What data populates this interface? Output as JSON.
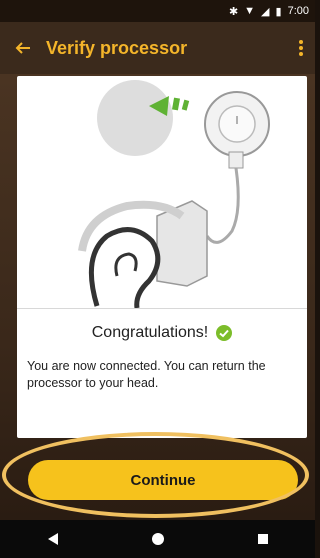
{
  "status_bar": {
    "bluetooth_icon": "bluetooth-icon",
    "wifi_icon": "wifi-icon",
    "signal_icon": "signal-icon",
    "battery_icon": "battery-icon",
    "time": "7:00"
  },
  "app_bar": {
    "back_icon": "arrow-left-icon",
    "title": "Verify processor",
    "menu_icon": "more-vert-icon"
  },
  "card": {
    "heading": "Congratulations!",
    "check_icon": "check-circle-icon",
    "message": "You are now connected. You can return the processor to your head."
  },
  "actions": {
    "continue_label": "Continue"
  },
  "nav_bar": {
    "back_icon": "triangle-back-icon",
    "home_icon": "circle-home-icon",
    "recents_icon": "square-recents-icon"
  },
  "colors": {
    "accent": "#f4b52a",
    "button": "#f6c21c",
    "success": "#7cbd2a",
    "app_bar": "#3b2a1c"
  }
}
